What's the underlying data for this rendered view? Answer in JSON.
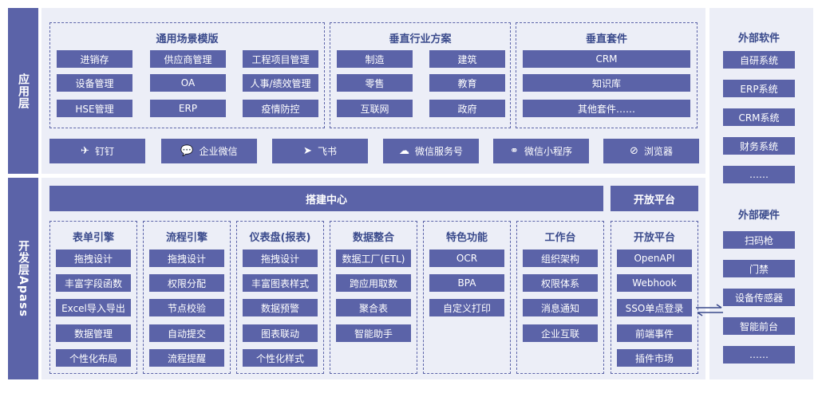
{
  "side_labels": {
    "app": "应用层",
    "dev": "开发层Apass"
  },
  "general": {
    "title": "通用场景模版",
    "items": [
      "进销存",
      "供应商管理",
      "工程项目管理",
      "设备管理",
      "OA",
      "人事/绩效管理",
      "HSE管理",
      "ERP",
      "疫情防控"
    ]
  },
  "vertical": {
    "title": "垂直行业方案",
    "items": [
      "制造",
      "建筑",
      "零售",
      "教育",
      "互联网",
      "政府"
    ]
  },
  "suite": {
    "title": "垂直套件",
    "items": [
      "CRM",
      "知识库",
      "其他套件……"
    ]
  },
  "channels": [
    {
      "icon": "dingtalk-icon",
      "glyph": "✈",
      "label": "钉钉"
    },
    {
      "icon": "wecom-icon",
      "glyph": "💬",
      "label": "企业微信"
    },
    {
      "icon": "feishu-icon",
      "glyph": "➤",
      "label": "飞书"
    },
    {
      "icon": "wechat-icon",
      "glyph": "☁",
      "label": "微信服务号"
    },
    {
      "icon": "miniprogram-icon",
      "glyph": "⚭",
      "label": "微信小程序"
    },
    {
      "icon": "browser-icon",
      "glyph": "⊘",
      "label": "浏览器"
    }
  ],
  "build_center": "搭建中心",
  "open_platform_bar": "开放平台",
  "modules": [
    {
      "title": "表单引擎",
      "items": [
        "拖拽设计",
        "丰富字段函数",
        "Excel导入导出",
        "数据管理",
        "个性化布局"
      ]
    },
    {
      "title": "流程引擎",
      "items": [
        "拖拽设计",
        "权限分配",
        "节点校验",
        "自动提交",
        "流程提醒"
      ]
    },
    {
      "title": "仪表盘(报表)",
      "items": [
        "拖拽设计",
        "丰富图表样式",
        "数据预警",
        "图表联动",
        "个性化样式"
      ]
    },
    {
      "title": "数据整合",
      "items": [
        "数据工厂(ETL)",
        "跨应用取数",
        "聚合表",
        "智能助手"
      ]
    },
    {
      "title": "特色功能",
      "items": [
        "OCR",
        "BPA",
        "自定义打印"
      ]
    },
    {
      "title": "工作台",
      "items": [
        "组织架构",
        "权限体系",
        "消息通知",
        "企业互联"
      ]
    },
    {
      "title": "开放平台",
      "items": [
        "OpenAPI",
        "Webhook",
        "SSO单点登录",
        "前端事件",
        "插件市场"
      ]
    }
  ],
  "external_software": {
    "title": "外部软件",
    "items": [
      "自研系统",
      "ERP系统",
      "CRM系统",
      "财务系统",
      "……"
    ]
  },
  "external_hardware": {
    "title": "外部硬件",
    "items": [
      "扫码枪",
      "门禁",
      "设备传感器",
      "智能前台",
      "……"
    ]
  },
  "colors": {
    "primary": "#5b63a8",
    "panel": "#eceef7",
    "title": "#3a4a8c"
  }
}
